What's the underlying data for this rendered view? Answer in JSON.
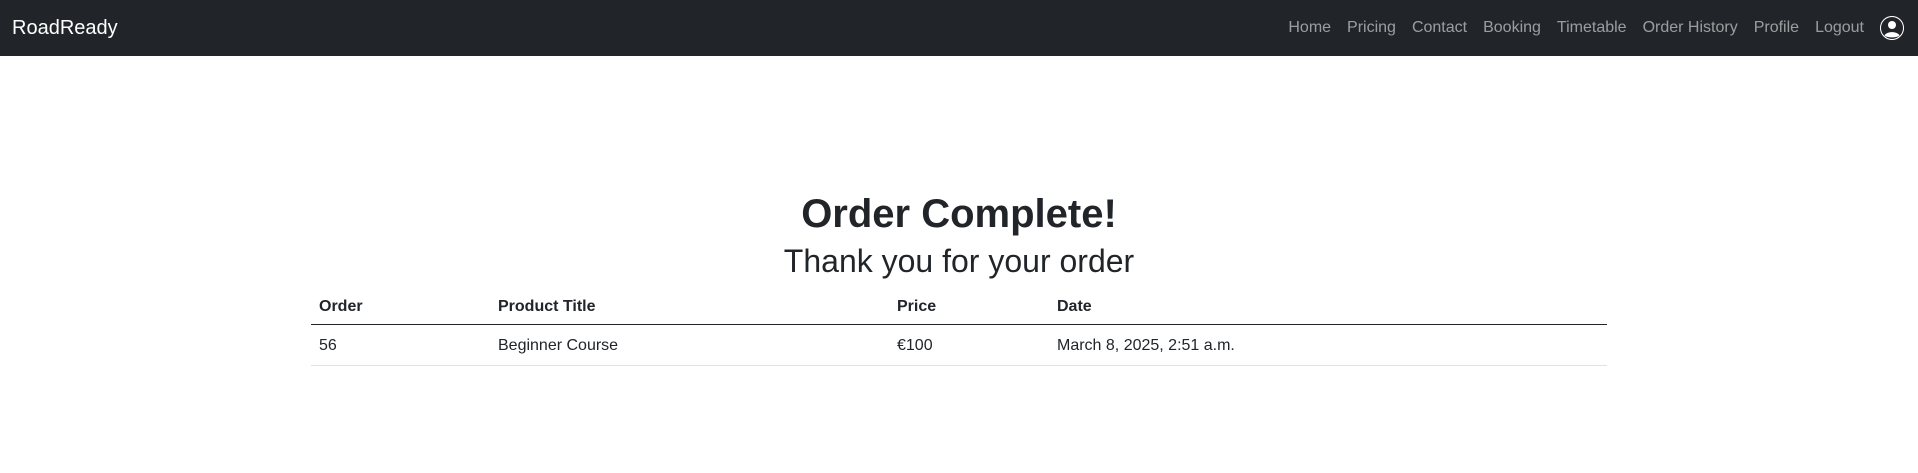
{
  "nav": {
    "brand": "RoadReady",
    "links": [
      "Home",
      "Pricing",
      "Contact",
      "Booking",
      "Timetable",
      "Order History",
      "Profile",
      "Logout"
    ],
    "avatar_icon": "user-circle-icon"
  },
  "main": {
    "title": "Order Complete!",
    "subtitle": "Thank you for your order",
    "table": {
      "headers": [
        "Order",
        "Product Title",
        "Price",
        "Date"
      ],
      "rows": [
        [
          "56",
          "Beginner Course",
          "€100",
          "March 8, 2025, 2:51 a.m."
        ]
      ]
    }
  }
}
